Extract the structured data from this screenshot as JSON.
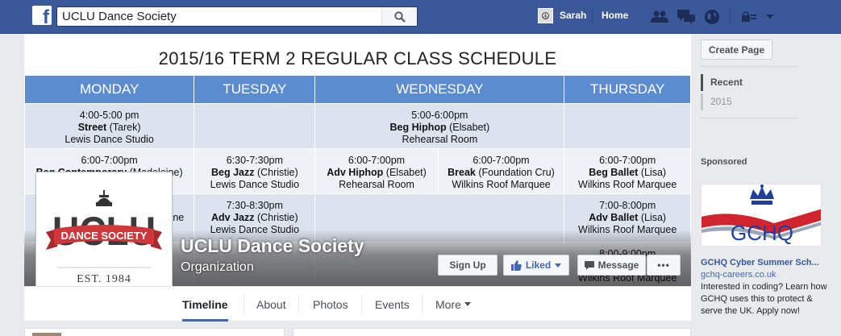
{
  "topbar": {
    "logo": "f",
    "search_value": "UCLU Dance Society",
    "user_name": "Sarah",
    "home_label": "Home",
    "icons": [
      "facebook-logo-icon",
      "search-icon",
      "friend-requests-icon",
      "messages-icon",
      "notifications-globe-icon",
      "privacy-lock-icon",
      "account-menu-chevron-icon"
    ]
  },
  "cover": {
    "schedule_title": "2015/16 TERM 2 REGULAR CLASS SCHEDULE",
    "days": [
      "MONDAY",
      "TUESDAY",
      "WEDNESDAY",
      "THURSDAY"
    ],
    "rows": {
      "r1": {
        "mon": {
          "time": "4:00-5:00 pm",
          "class": "Street",
          "teacher": " (Tarek)",
          "venue": "Lewis Dance Studio"
        },
        "wed": {
          "time": "5:00-6:00pm",
          "class": "Beg Hiphop",
          "teacher": " (Elsabet)",
          "venue": "Rehearsal Room"
        }
      },
      "r2": {
        "mon": {
          "time": "6:00-7:00pm",
          "class": "Beg Contemporary",
          "teacher": " (Madeleine)"
        },
        "tue": {
          "time": "6:30-7:30pm",
          "class": "Beg Jazz",
          "teacher": " (Christie)",
          "venue": "Lewis Dance Studio"
        },
        "wed1": {
          "time": "6:00-7:00pm",
          "class": "Adv Hiphop",
          "teacher": " (Elsabet)",
          "venue": "Rehearsal Room"
        },
        "wed2": {
          "time": "6:00-7:00pm",
          "class": "Break",
          "teacher": "  (Foundation Cru)",
          "venue": "Wilkins Roof Marquee"
        },
        "thu": {
          "time": "6:00-7:00pm",
          "class": "Beg Ballet",
          "teacher": " (Lisa)",
          "venue": "Wilkins Roof Marquee"
        }
      },
      "r3": {
        "mon": {
          "partial": "ne"
        },
        "tue": {
          "time": "7:30-8:30pm",
          "class": "Adv Jazz",
          "teacher": " (Christie)",
          "venue": "Lewis Dance Studio"
        },
        "thu": {
          "time": "7:00-8:00pm",
          "class": "Adv Ballet",
          "teacher": " (Lisa)",
          "venue": "Wilkins Roof Marquee"
        }
      },
      "r4": {
        "thu": {
          "time": "8:00-9:00pm",
          "venue": "Wilkins Roof Marquee"
        }
      }
    }
  },
  "profile": {
    "logo_text": "UCLU",
    "banner_text": "DANCE SOCIETY",
    "est_text": "EST. 1984",
    "name": "UCLU Dance Society",
    "category": "Organization"
  },
  "actions": {
    "signup": "Sign Up",
    "liked": "Liked",
    "message": "Message",
    "more": "•••"
  },
  "tabs": [
    "Timeline",
    "About",
    "Photos",
    "Events",
    "More"
  ],
  "sidebar": {
    "create_page": "Create Page",
    "years": [
      "Recent",
      "2015"
    ],
    "sponsored_label": "Sponsored",
    "ad": {
      "logo_text": "GCHQ",
      "title": "GCHQ Cyber Summer Sch...",
      "url": "gchq-careers.co.uk",
      "body": "Interested in coding? Learn how GCHQ uses this to protect & serve the UK. Apply now!"
    }
  },
  "colors": {
    "fb_blue": "#3b5998",
    "schedule_header": "#5b8ccf",
    "cell_dark": "#dce3ef",
    "cell_light": "#eef1f6",
    "ucl_red": "#d0373d",
    "gchq_blue": "#1f3f98"
  }
}
